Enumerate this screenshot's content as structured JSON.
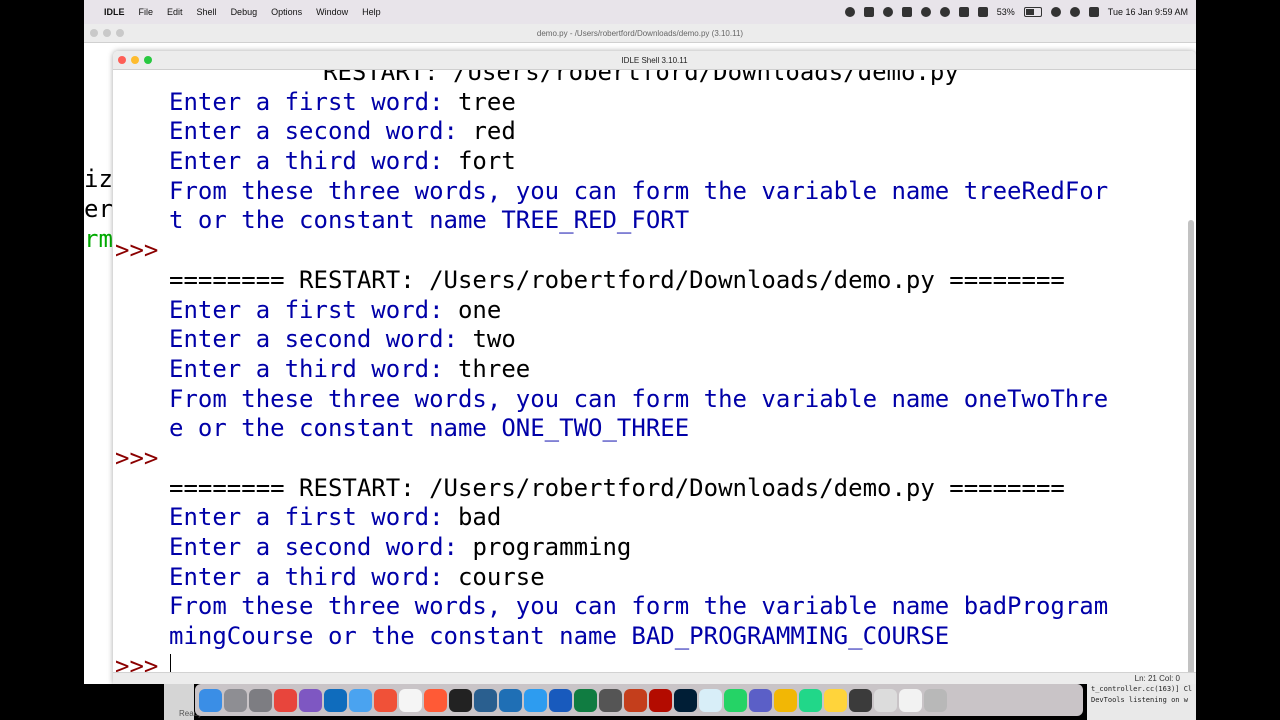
{
  "menubar": {
    "apple": "",
    "app_name": "IDLE",
    "items": [
      "File",
      "Edit",
      "Shell",
      "Debug",
      "Options",
      "Window",
      "Help"
    ],
    "battery": "53%",
    "datetime": "Tue 16 Jan  9:59 AM"
  },
  "editor_window": {
    "title": "demo.py - /Users/robertford/Downloads/demo.py (3.10.11)",
    "code_fragments": [
      {
        "text": "iz",
        "color": "#000000"
      },
      {
        "text": "er",
        "color": "#000000"
      },
      {
        "text": "rm",
        "color": "#00aa00"
      }
    ]
  },
  "shell": {
    "title": "IDLE Shell 3.10.11",
    "lines": [
      {
        "prompt": "",
        "text": "RESTART: /Users/robertford/Downloads/demo.py",
        "kind": "restart"
      },
      {
        "prompt": "",
        "text": "Enter a first word: ",
        "input": "tree",
        "kind": "stdout"
      },
      {
        "prompt": "",
        "text": "Enter a second word: ",
        "input": "red",
        "kind": "stdout"
      },
      {
        "prompt": "",
        "text": "Enter a third word: ",
        "input": "fort",
        "kind": "stdout"
      },
      {
        "prompt": "",
        "text": "From these three words, you can form the variable name treeRedFor",
        "kind": "stdout"
      },
      {
        "prompt": "",
        "text": "t or the constant name TREE_RED_FORT",
        "kind": "stdout"
      },
      {
        "prompt": ">>>",
        "text": "",
        "kind": "prompt"
      },
      {
        "prompt": "",
        "text": "======== RESTART: /Users/robertford/Downloads/demo.py ========",
        "kind": "restart"
      },
      {
        "prompt": "",
        "text": "Enter a first word: ",
        "input": "one",
        "kind": "stdout"
      },
      {
        "prompt": "",
        "text": "Enter a second word: ",
        "input": "two",
        "kind": "stdout"
      },
      {
        "prompt": "",
        "text": "Enter a third word: ",
        "input": "three",
        "kind": "stdout"
      },
      {
        "prompt": "",
        "text": "From these three words, you can form the variable name oneTwoThre",
        "kind": "stdout"
      },
      {
        "prompt": "",
        "text": "e or the constant name ONE_TWO_THREE",
        "kind": "stdout"
      },
      {
        "prompt": ">>>",
        "text": "",
        "kind": "prompt"
      },
      {
        "prompt": "",
        "text": "======== RESTART: /Users/robertford/Downloads/demo.py ========",
        "kind": "restart"
      },
      {
        "prompt": "",
        "text": "Enter a first word: ",
        "input": "bad",
        "kind": "stdout"
      },
      {
        "prompt": "",
        "text": "Enter a second word: ",
        "input": "programming",
        "kind": "stdout"
      },
      {
        "prompt": "",
        "text": "Enter a third word: ",
        "input": "course",
        "kind": "stdout"
      },
      {
        "prompt": "",
        "text": "From these three words, you can form the variable name badProgram",
        "kind": "stdout"
      },
      {
        "prompt": "",
        "text": "mingCourse or the constant name BAD_PROGRAMMING_COURSE",
        "kind": "stdout"
      },
      {
        "prompt": ">>>",
        "text": "",
        "kind": "prompt",
        "cursor": true
      }
    ],
    "status": "Ln: 21  Col: 0"
  },
  "dock": {
    "icons": [
      {
        "name": "finder-icon",
        "color": "#3a8ee6"
      },
      {
        "name": "launchpad-icon",
        "color": "#8e8e93"
      },
      {
        "name": "system-settings-icon",
        "color": "#7d7d82"
      },
      {
        "name": "chrome-icon",
        "color": "#e8453c"
      },
      {
        "name": "github-desktop-icon",
        "color": "#7e57c2"
      },
      {
        "name": "outlook-icon",
        "color": "#0f6cbd"
      },
      {
        "name": "safari-icon",
        "color": "#4aa3f0"
      },
      {
        "name": "swift-icon",
        "color": "#f05138"
      },
      {
        "name": "textedit-icon",
        "color": "#f5f5f5"
      },
      {
        "name": "codepen-icon",
        "color": "#ff5a36"
      },
      {
        "name": "terminal-icon",
        "color": "#222222"
      },
      {
        "name": "pgadmin-icon",
        "color": "#2a5f8f"
      },
      {
        "name": "vmware-icon",
        "color": "#1f6fb5"
      },
      {
        "name": "app-store-icon",
        "color": "#2d9cf0"
      },
      {
        "name": "word-icon",
        "color": "#185abd"
      },
      {
        "name": "excel-icon",
        "color": "#107c41"
      },
      {
        "name": "calculator-icon",
        "color": "#555555"
      },
      {
        "name": "powerpoint-icon",
        "color": "#c43e1c"
      },
      {
        "name": "acrobat-icon",
        "color": "#b30b00"
      },
      {
        "name": "photoshop-icon",
        "color": "#001e36"
      },
      {
        "name": "preview-icon",
        "color": "#d8eef8"
      },
      {
        "name": "whatsapp-icon",
        "color": "#25d366"
      },
      {
        "name": "teams-icon",
        "color": "#5b5fc7"
      },
      {
        "name": "chrome-canary-icon",
        "color": "#f2b705"
      },
      {
        "name": "pycharm-icon",
        "color": "#21d789"
      },
      {
        "name": "python-launcher-icon",
        "color": "#ffd43b"
      },
      {
        "name": "quicktime-icon",
        "color": "#3b3b3b"
      },
      {
        "name": "document-icon",
        "color": "#dcdcdc"
      },
      {
        "name": "keyboard-icon",
        "color": "#f2f2f2"
      },
      {
        "name": "trash-icon",
        "color": "#b8b8b8"
      }
    ]
  },
  "left_strip_text": "Ready",
  "right_strip_lines": [
    "t_controller.cc(163)] Cl",
    "DevTools listening on w"
  ]
}
